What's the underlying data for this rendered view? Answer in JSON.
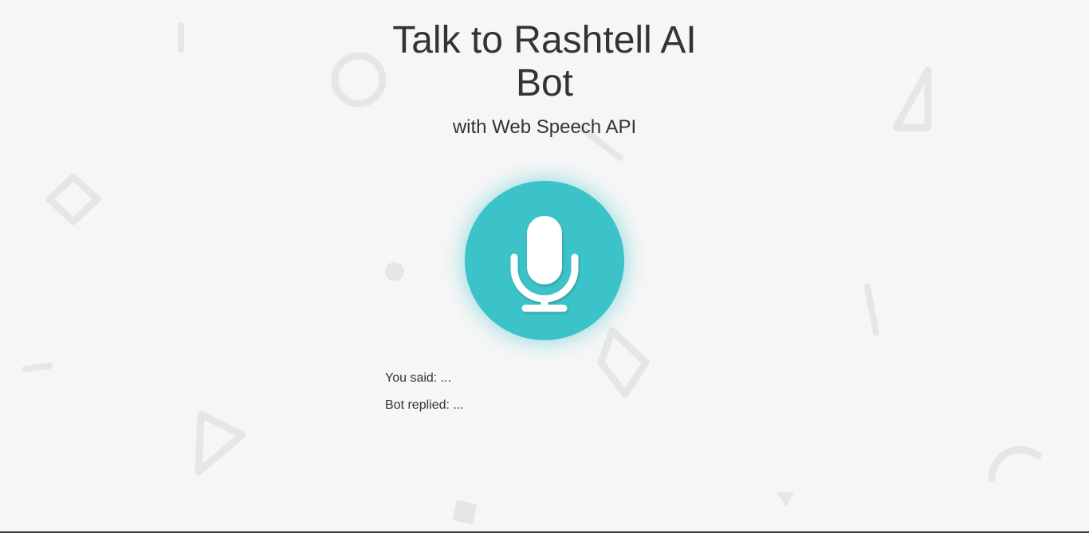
{
  "header": {
    "title": "Talk to Rashtell AI Bot",
    "subtitle": "with Web Speech API"
  },
  "talk_button": {
    "icon": "microphone-icon",
    "color": "#3cc3c9"
  },
  "transcript": {
    "you_said_label": "You said:",
    "you_said_value": "...",
    "bot_replied_label": "Bot replied:",
    "bot_replied_value": "..."
  },
  "theme": {
    "background": "#f6f6f6",
    "text": "#333333",
    "accent": "#3cc3c9",
    "decoration": "#e6e6e6"
  }
}
